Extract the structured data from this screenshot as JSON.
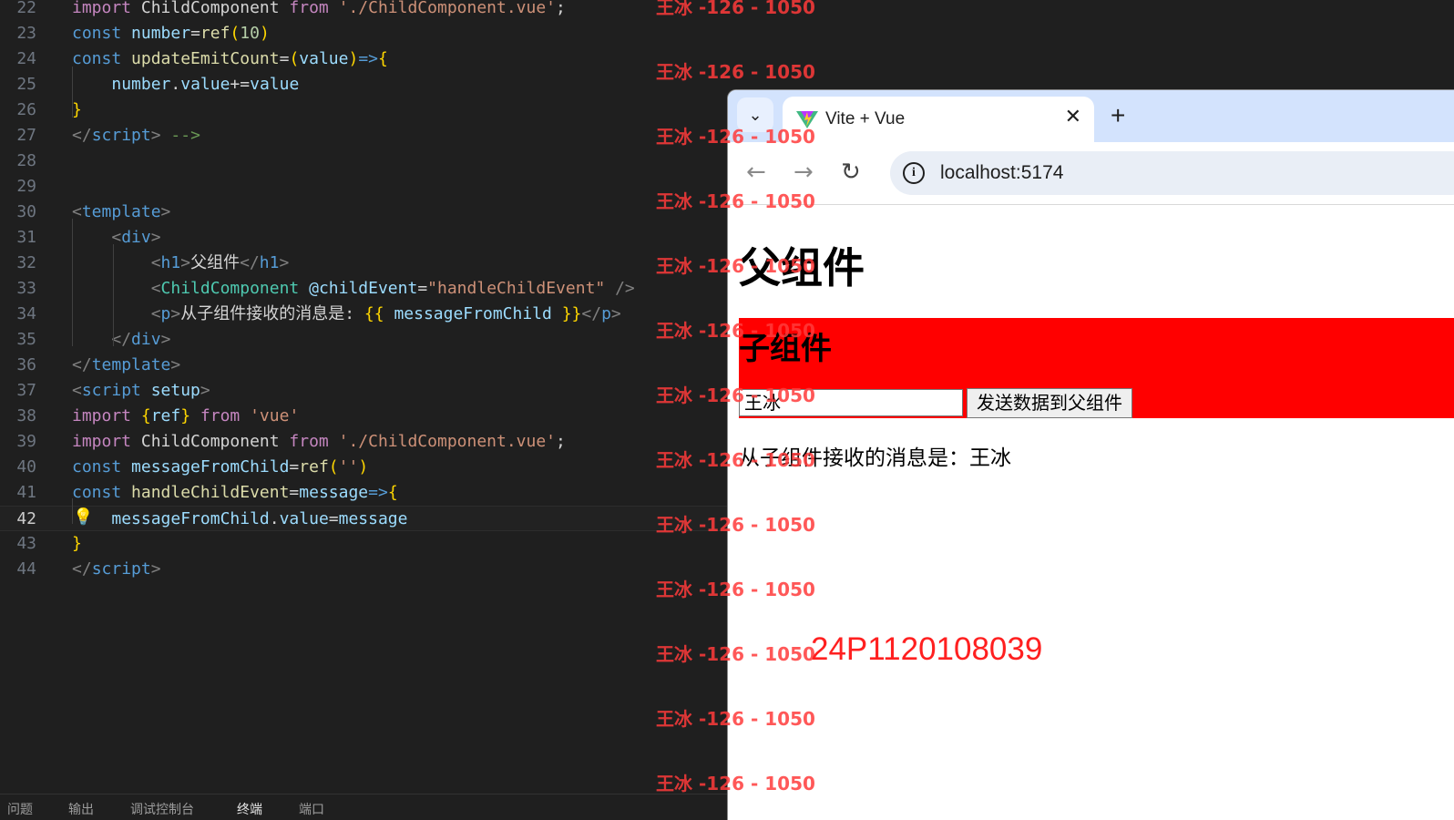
{
  "editor": {
    "lines": [
      {
        "n": "22",
        "parts": [
          [
            "kw2",
            "import "
          ],
          [
            "txt",
            "ChildComponent "
          ],
          [
            "kw2",
            "from "
          ],
          [
            "str",
            "'./ChildComponent.vue'"
          ],
          [
            "txt",
            ";"
          ]
        ]
      },
      {
        "n": "23",
        "parts": [
          [
            "kw",
            "const "
          ],
          [
            "var",
            "number"
          ],
          [
            "txt",
            "="
          ],
          [
            "fn",
            "ref"
          ],
          [
            "ybr",
            "("
          ],
          [
            "num",
            "10"
          ],
          [
            "ybr",
            ")"
          ]
        ]
      },
      {
        "n": "24",
        "parts": [
          [
            "kw",
            "const "
          ],
          [
            "fn",
            "updateEmitCount"
          ],
          [
            "txt",
            "="
          ],
          [
            "ybr",
            "("
          ],
          [
            "var",
            "value"
          ],
          [
            "ybr",
            ")"
          ],
          [
            "kw",
            "=>"
          ],
          [
            "ybr",
            "{"
          ]
        ]
      },
      {
        "n": "25",
        "parts": [
          [
            "txt",
            "    "
          ],
          [
            "var",
            "number"
          ],
          [
            "txt",
            "."
          ],
          [
            "var",
            "value"
          ],
          [
            "txt",
            "+="
          ],
          [
            "var",
            "value"
          ]
        ]
      },
      {
        "n": "26",
        "parts": [
          [
            "ybr",
            "}"
          ]
        ]
      },
      {
        "n": "27",
        "parts": [
          [
            "br",
            "</"
          ],
          [
            "tag",
            "script"
          ],
          [
            "br",
            ">"
          ],
          [
            "cmt",
            " -->"
          ]
        ]
      },
      {
        "n": "28",
        "parts": []
      },
      {
        "n": "29",
        "parts": []
      },
      {
        "n": "30",
        "parts": [
          [
            "br",
            "<"
          ],
          [
            "tag",
            "template"
          ],
          [
            "br",
            ">"
          ]
        ]
      },
      {
        "n": "31",
        "parts": [
          [
            "txt",
            "    "
          ],
          [
            "br",
            "<"
          ],
          [
            "tag",
            "div"
          ],
          [
            "br",
            ">"
          ]
        ]
      },
      {
        "n": "32",
        "parts": [
          [
            "txt",
            "        "
          ],
          [
            "br",
            "<"
          ],
          [
            "tag",
            "h1"
          ],
          [
            "br",
            ">"
          ],
          [
            "txt",
            "父组件"
          ],
          [
            "br",
            "</"
          ],
          [
            "tag",
            "h1"
          ],
          [
            "br",
            ">"
          ]
        ]
      },
      {
        "n": "33",
        "parts": [
          [
            "txt",
            "        "
          ],
          [
            "br",
            "<"
          ],
          [
            "comp",
            "ChildComponent "
          ],
          [
            "attr",
            "@childEvent"
          ],
          [
            "txt",
            "="
          ],
          [
            "str",
            "\"handleChildEvent\""
          ],
          [
            "br",
            " />"
          ]
        ]
      },
      {
        "n": "34",
        "parts": [
          [
            "txt",
            "        "
          ],
          [
            "br",
            "<"
          ],
          [
            "tag",
            "p"
          ],
          [
            "br",
            ">"
          ],
          [
            "txt",
            "从子组件接收的消息是: "
          ],
          [
            "ybr",
            "{{"
          ],
          [
            "var",
            " messageFromChild "
          ],
          [
            "ybr",
            "}}"
          ],
          [
            "br",
            "</"
          ],
          [
            "tag",
            "p"
          ],
          [
            "br",
            ">"
          ]
        ]
      },
      {
        "n": "35",
        "parts": [
          [
            "txt",
            "    "
          ],
          [
            "br",
            "</"
          ],
          [
            "tag",
            "div"
          ],
          [
            "br",
            ">"
          ]
        ]
      },
      {
        "n": "36",
        "parts": [
          [
            "br",
            "</"
          ],
          [
            "tag",
            "template"
          ],
          [
            "br",
            ">"
          ]
        ]
      },
      {
        "n": "37",
        "parts": [
          [
            "br",
            "<"
          ],
          [
            "tag",
            "script "
          ],
          [
            "attr",
            "setup"
          ],
          [
            "br",
            ">"
          ]
        ]
      },
      {
        "n": "38",
        "parts": [
          [
            "kw2",
            "import "
          ],
          [
            "ybr",
            "{"
          ],
          [
            "var",
            "ref"
          ],
          [
            "ybr",
            "} "
          ],
          [
            "kw2",
            "from "
          ],
          [
            "str",
            "'vue'"
          ]
        ]
      },
      {
        "n": "39",
        "parts": [
          [
            "kw2",
            "import "
          ],
          [
            "txt",
            "ChildComponent "
          ],
          [
            "kw2",
            "from "
          ],
          [
            "str",
            "'./ChildComponent.vue'"
          ],
          [
            "txt",
            ";"
          ]
        ]
      },
      {
        "n": "40",
        "parts": [
          [
            "kw",
            "const "
          ],
          [
            "var",
            "messageFromChild"
          ],
          [
            "txt",
            "="
          ],
          [
            "fn",
            "ref"
          ],
          [
            "ybr",
            "("
          ],
          [
            "str",
            "''"
          ],
          [
            "ybr",
            ")"
          ]
        ]
      },
      {
        "n": "41",
        "parts": [
          [
            "kw",
            "const "
          ],
          [
            "fn",
            "handleChildEvent"
          ],
          [
            "txt",
            "="
          ],
          [
            "var",
            "message"
          ],
          [
            "kw",
            "=>"
          ],
          [
            "ybr",
            "{"
          ]
        ]
      },
      {
        "n": "42",
        "parts": [
          [
            "txt",
            "    "
          ],
          [
            "var",
            "messageFromChild"
          ],
          [
            "txt",
            "."
          ],
          [
            "var",
            "value"
          ],
          [
            "txt",
            "="
          ],
          [
            "var",
            "message"
          ]
        ]
      },
      {
        "n": "43",
        "parts": [
          [
            "ybr",
            "}"
          ]
        ]
      },
      {
        "n": "44",
        "parts": [
          [
            "br",
            "</"
          ],
          [
            "tag",
            "script"
          ],
          [
            "br",
            ">"
          ]
        ]
      }
    ],
    "active_line": "42",
    "bottom_tabs": [
      "问题",
      "输出",
      "调试控制台",
      "终端",
      "端口"
    ],
    "active_bottom_tab": "终端"
  },
  "browser": {
    "tab_title": "Vite + Vue",
    "url": "localhost:5174",
    "page": {
      "h1": "父组件",
      "child_title": "子组件",
      "input_value": "王冰",
      "send_button": "发送数据到父组件",
      "message_line": "从子组件接收的消息是：王冰"
    }
  },
  "watermark": {
    "text": "王冰 -126 - 1050",
    "student_id": "24P1120108039"
  },
  "colors": {
    "child_bg": "#ff0000",
    "watermark": "#ff3b3b"
  }
}
